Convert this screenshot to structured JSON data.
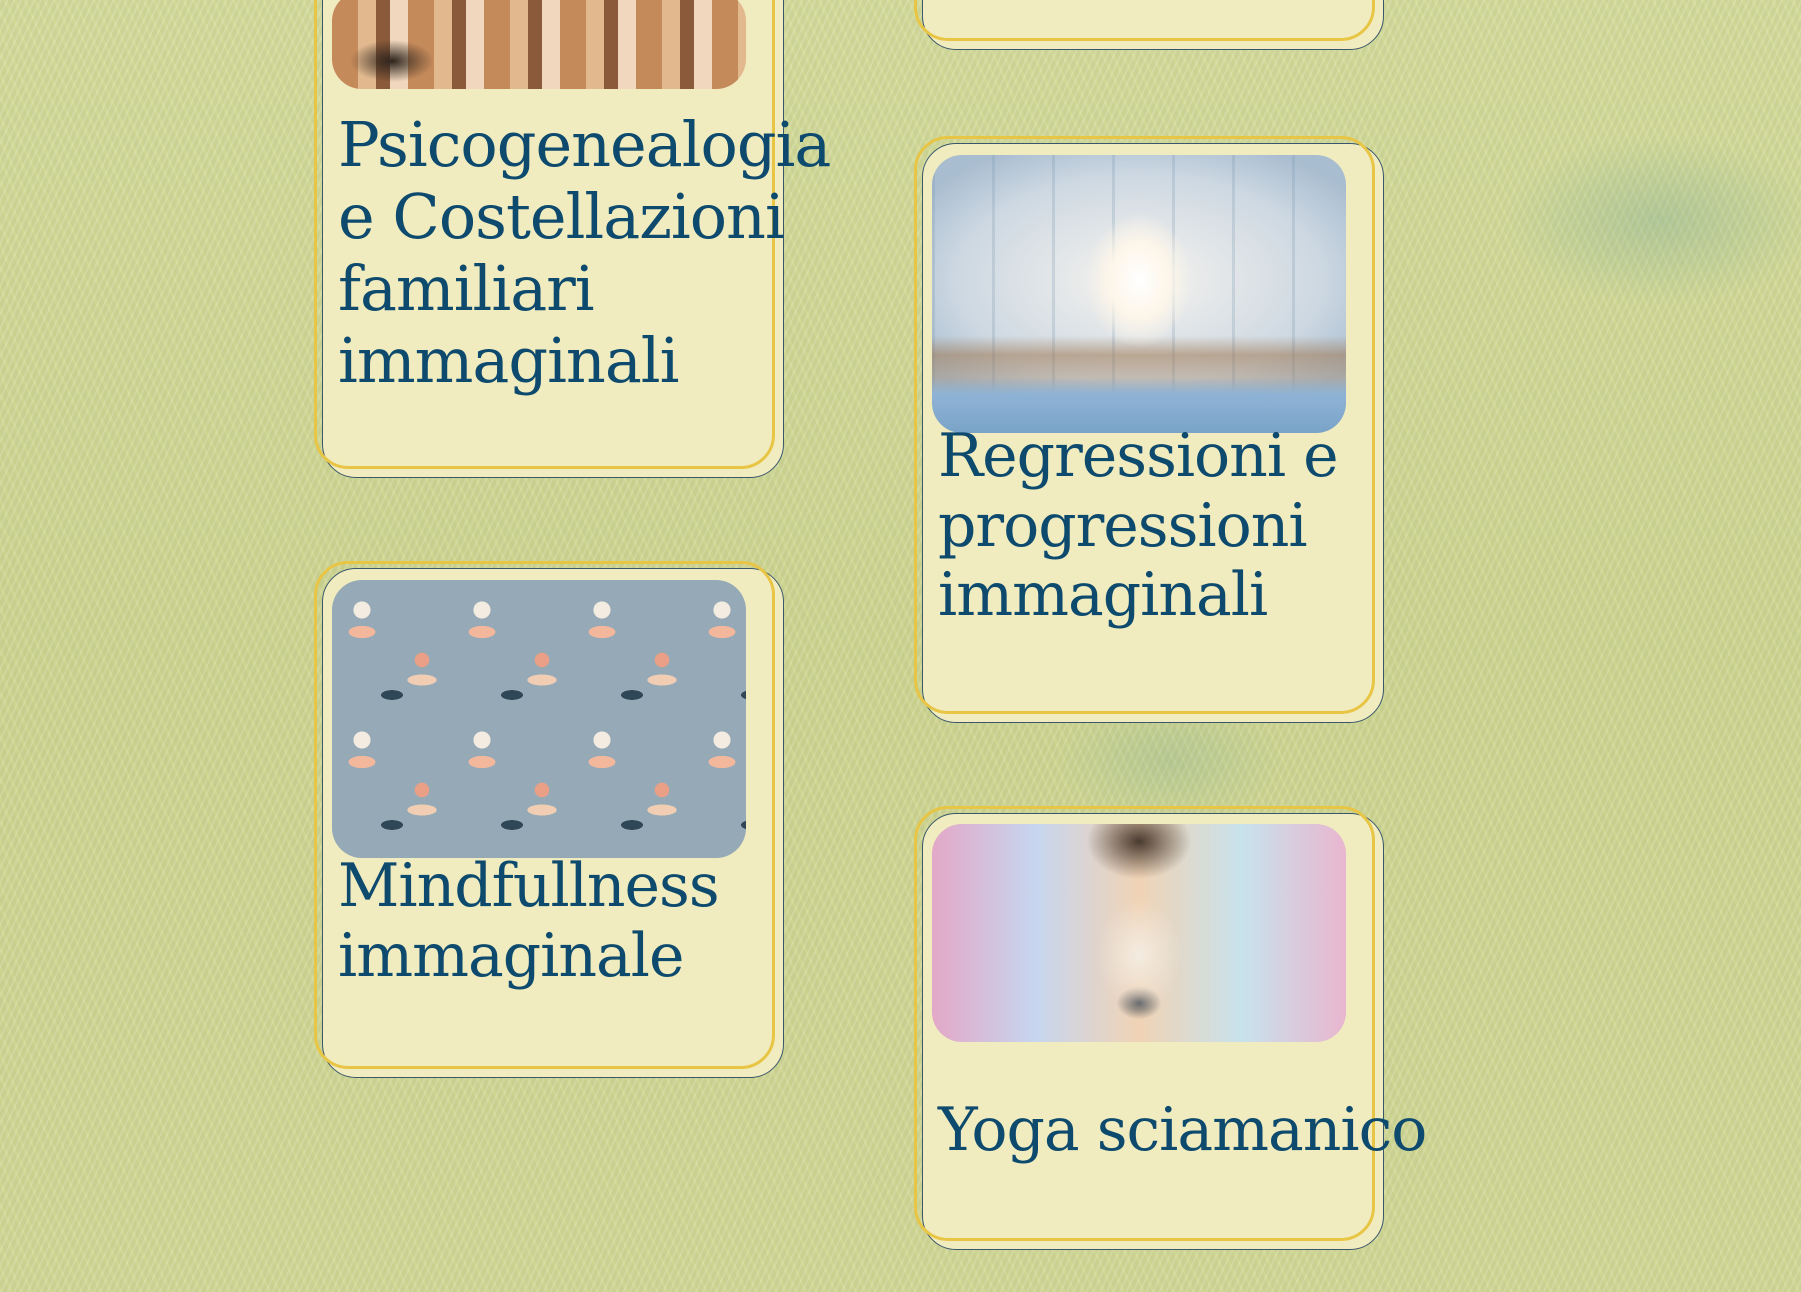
{
  "cards": [
    {
      "title_lines": [
        "Psicogenealogia",
        "e Costellazioni",
        "familiari",
        "immaginali"
      ],
      "image": "family-crowd-illustration"
    },
    {
      "title_lines": [],
      "image": ""
    },
    {
      "title_lines": [
        "Regressioni e",
        "progressioni",
        "immaginali"
      ],
      "image": "bright-corridor-photo"
    },
    {
      "title_lines": [
        "Mindfullness",
        "immaginale"
      ],
      "image": "buddha-lotus-pattern"
    },
    {
      "title_lines": [
        "Yoga sciamanico"
      ],
      "image": "shaman-woman-bear-wolf-art"
    }
  ],
  "colors": {
    "card_bg": "#f0ecbf",
    "title": "#0d4a6e",
    "accent_border": "#e8c544",
    "outline": "#39566b"
  }
}
